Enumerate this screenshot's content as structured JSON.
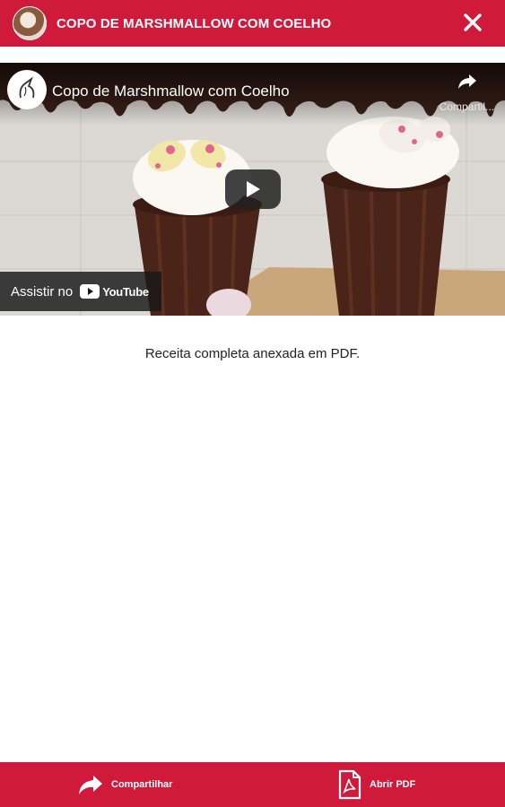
{
  "header": {
    "title": "COPO DE MARSHMALLOW COM COELHO",
    "close_icon": "close-icon"
  },
  "video": {
    "title": "Copo de Marshmallow com Coelho",
    "share_label": "Compartil...",
    "watch_on": "Assistir no",
    "youtube_label": "YouTube",
    "play_icon": "play-icon"
  },
  "content": {
    "description": "Receita completa anexada em PDF."
  },
  "footer": {
    "share_label": "Compartilhar",
    "pdf_label": "Abrir PDF"
  },
  "colors": {
    "brand": "#cf1a3c",
    "chocolate": "#3b2019"
  }
}
